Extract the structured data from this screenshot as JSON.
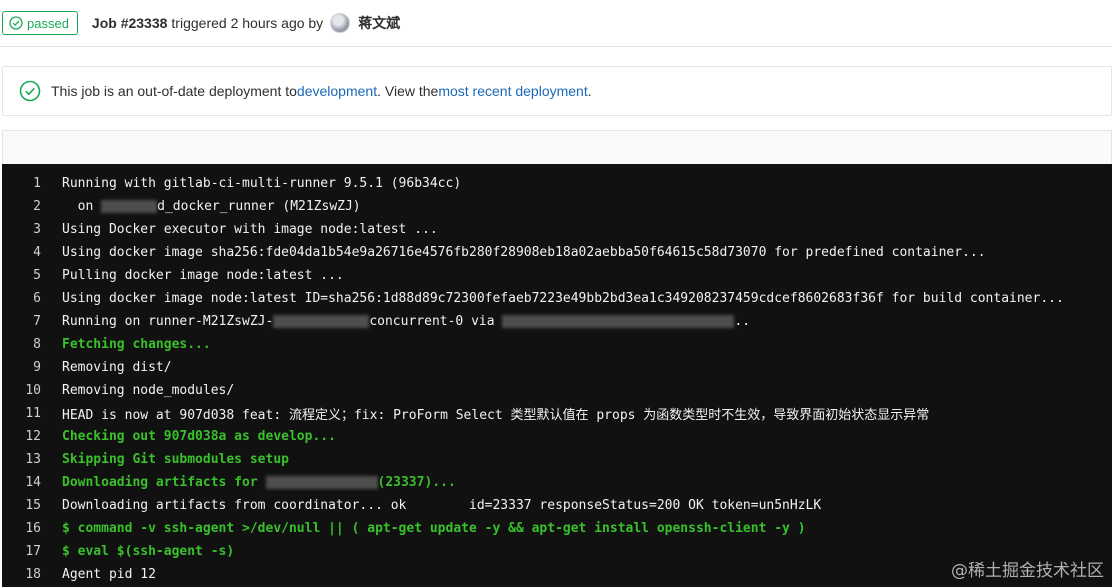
{
  "header": {
    "status_badge": "passed",
    "job_label": "Job #23338",
    "triggered_text": "triggered 2 hours ago by",
    "user_name": "蒋文斌"
  },
  "notice": {
    "prefix": "This job is an out-of-date deployment to ",
    "env_link": "development",
    "middle": ". View the ",
    "recent_link": "most recent deployment",
    "suffix": "."
  },
  "log": {
    "lines": [
      {
        "n": "1",
        "a": "Running with gitlab-ci-multi-runner 9.5.1 (96b34cc)"
      },
      {
        "n": "2",
        "a": "  on ",
        "b": "d_docker_runner (M21ZswZJ)"
      },
      {
        "n": "3",
        "a": "Using Docker executor with image node:latest ..."
      },
      {
        "n": "4",
        "a": "Using docker image sha256:fde04da1b54e9a26716e4576fb280f28908eb18a02aebba50f64615c58d73070 for predefined container..."
      },
      {
        "n": "5",
        "a": "Pulling docker image node:latest ..."
      },
      {
        "n": "6",
        "a": "Using docker image node:latest ID=sha256:1d88d89c72300fefaeb7223e49bb2bd3ea1c349208237459cdcef8602683f36f for build container..."
      },
      {
        "n": "7",
        "a": "Running on runner-M21ZswZJ-",
        "b": "concurrent-0 via ",
        "c": ".."
      },
      {
        "n": "8",
        "a": "Fetching changes..."
      },
      {
        "n": "9",
        "a": "Removing dist/"
      },
      {
        "n": "10",
        "a": "Removing node_modules/"
      },
      {
        "n": "11",
        "a": "HEAD is now at 907d038 feat: 流程定义；fix: ProForm Select 类型默认值在 props 为函数类型时不生效，导致界面初始状态显示异常"
      },
      {
        "n": "12",
        "a": "Checking out 907d038a as develop..."
      },
      {
        "n": "13",
        "a": "Skipping Git submodules setup"
      },
      {
        "n": "14",
        "a": "Downloading artifacts for ",
        "b": "(23337)..."
      },
      {
        "n": "15",
        "a": "Downloading artifacts from coordinator... ok        id=23337 responseStatus=200 OK token=un5nHzLK"
      },
      {
        "n": "16",
        "a": "$ command -v ssh-agent >/dev/null || ( apt-get update -y && apt-get install openssh-client -y )"
      },
      {
        "n": "17",
        "a": "$ eval $(ssh-agent -s)"
      },
      {
        "n": "18",
        "a": "Agent pid 12"
      }
    ]
  },
  "watermark": "@稀土掘金技术社区",
  "colors": {
    "success": "#1aaa55",
    "link": "#1b69b6",
    "log_bg": "#111111",
    "log_green": "#39c12b"
  },
  "icons": {
    "status": "check-circle-icon",
    "notice": "check-circle-icon"
  }
}
